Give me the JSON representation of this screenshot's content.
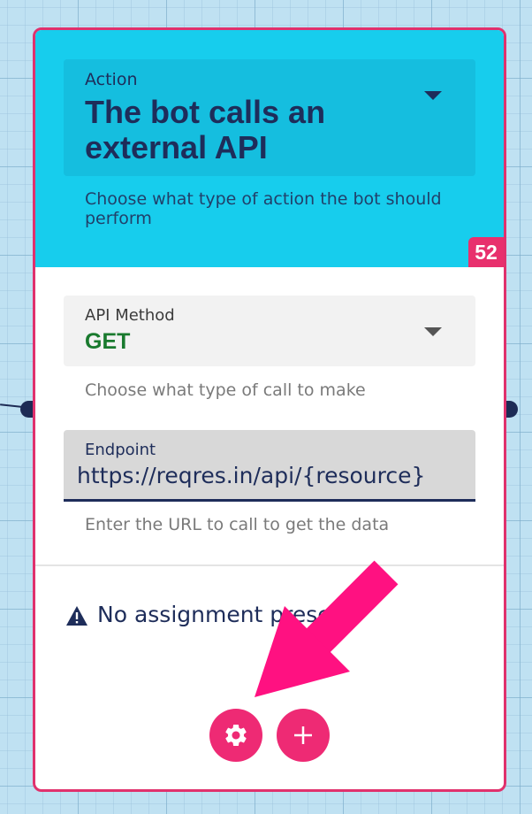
{
  "action": {
    "label": "Action",
    "value": "The bot calls an external API",
    "help": "Choose what type of action the bot should perform"
  },
  "badge": "52",
  "api_method": {
    "label": "API Method",
    "value": "GET",
    "help": "Choose what type of call to make"
  },
  "endpoint": {
    "label": "Endpoint",
    "value": "https://reqres.in/api/{resource}",
    "help": "Enter the URL to call to get the data"
  },
  "warning": {
    "text": "No assignment present",
    "icon": "warning-icon"
  },
  "buttons": {
    "settings_icon": "gear-icon",
    "add_icon": "plus-icon"
  },
  "colors": {
    "card_border": "#e0316d",
    "header_background": "#17cded",
    "method_value": "#197a2e",
    "button": "#ee2a74",
    "arrow": "#ff1181"
  }
}
